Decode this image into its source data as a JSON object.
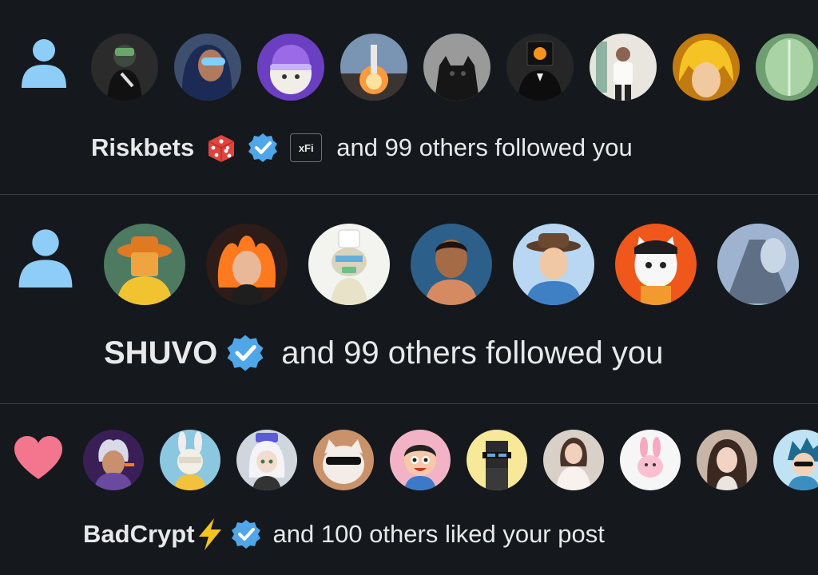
{
  "colors": {
    "background": "#15181c",
    "text": "#e7e9ea",
    "follow_icon": "#8ecdf7",
    "like_icon": "#f4768e",
    "verified_badge": "#4fa6e8",
    "divider": "#3a3f44"
  },
  "notifications": [
    {
      "kind": "follow",
      "icon": "person-icon",
      "user": "Riskbets",
      "decorations": [
        "dice-emoji",
        "verified-badge-icon",
        "xfi-tag"
      ],
      "tag_text": "xFi",
      "rest": "and 99 others followed you",
      "avatar_count": 9
    },
    {
      "kind": "follow",
      "icon": "person-icon",
      "user": "SHUVO",
      "decorations": [
        "verified-badge-icon"
      ],
      "rest": "and 99 others followed you",
      "avatar_count": 7
    },
    {
      "kind": "like",
      "icon": "heart-icon",
      "user": "BadCrypt",
      "decorations": [
        "lightning-emoji",
        "verified-badge-icon"
      ],
      "rest": "and 100 others liked your post",
      "avatar_count": 10
    }
  ]
}
